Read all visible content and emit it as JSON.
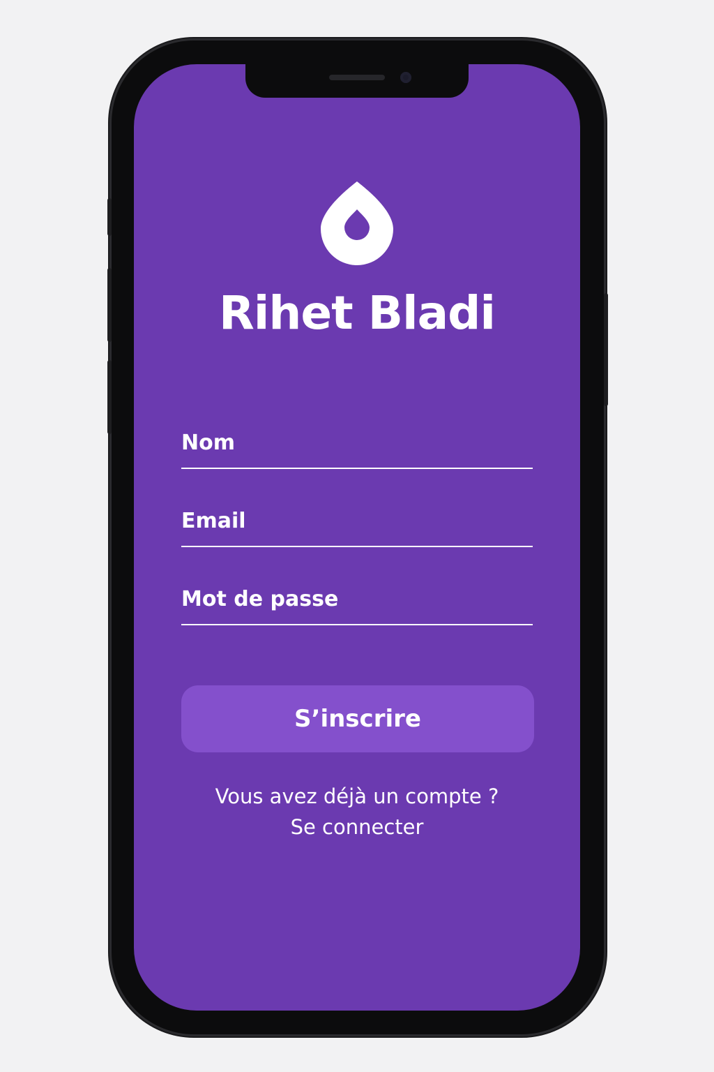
{
  "app": {
    "title": "Rihet Bladi",
    "logo_icon": "droplet-icon"
  },
  "form": {
    "fields": [
      {
        "label": "Nom"
      },
      {
        "label": "Email"
      },
      {
        "label": "Mot de passe"
      }
    ],
    "submit_label": "S’inscrire"
  },
  "footer": {
    "prompt": "Vous avez déjà un compte ?",
    "login_link": "Se connecter"
  },
  "colors": {
    "background": "#6b3ab0",
    "button": "#8450cc",
    "text": "#ffffff"
  }
}
